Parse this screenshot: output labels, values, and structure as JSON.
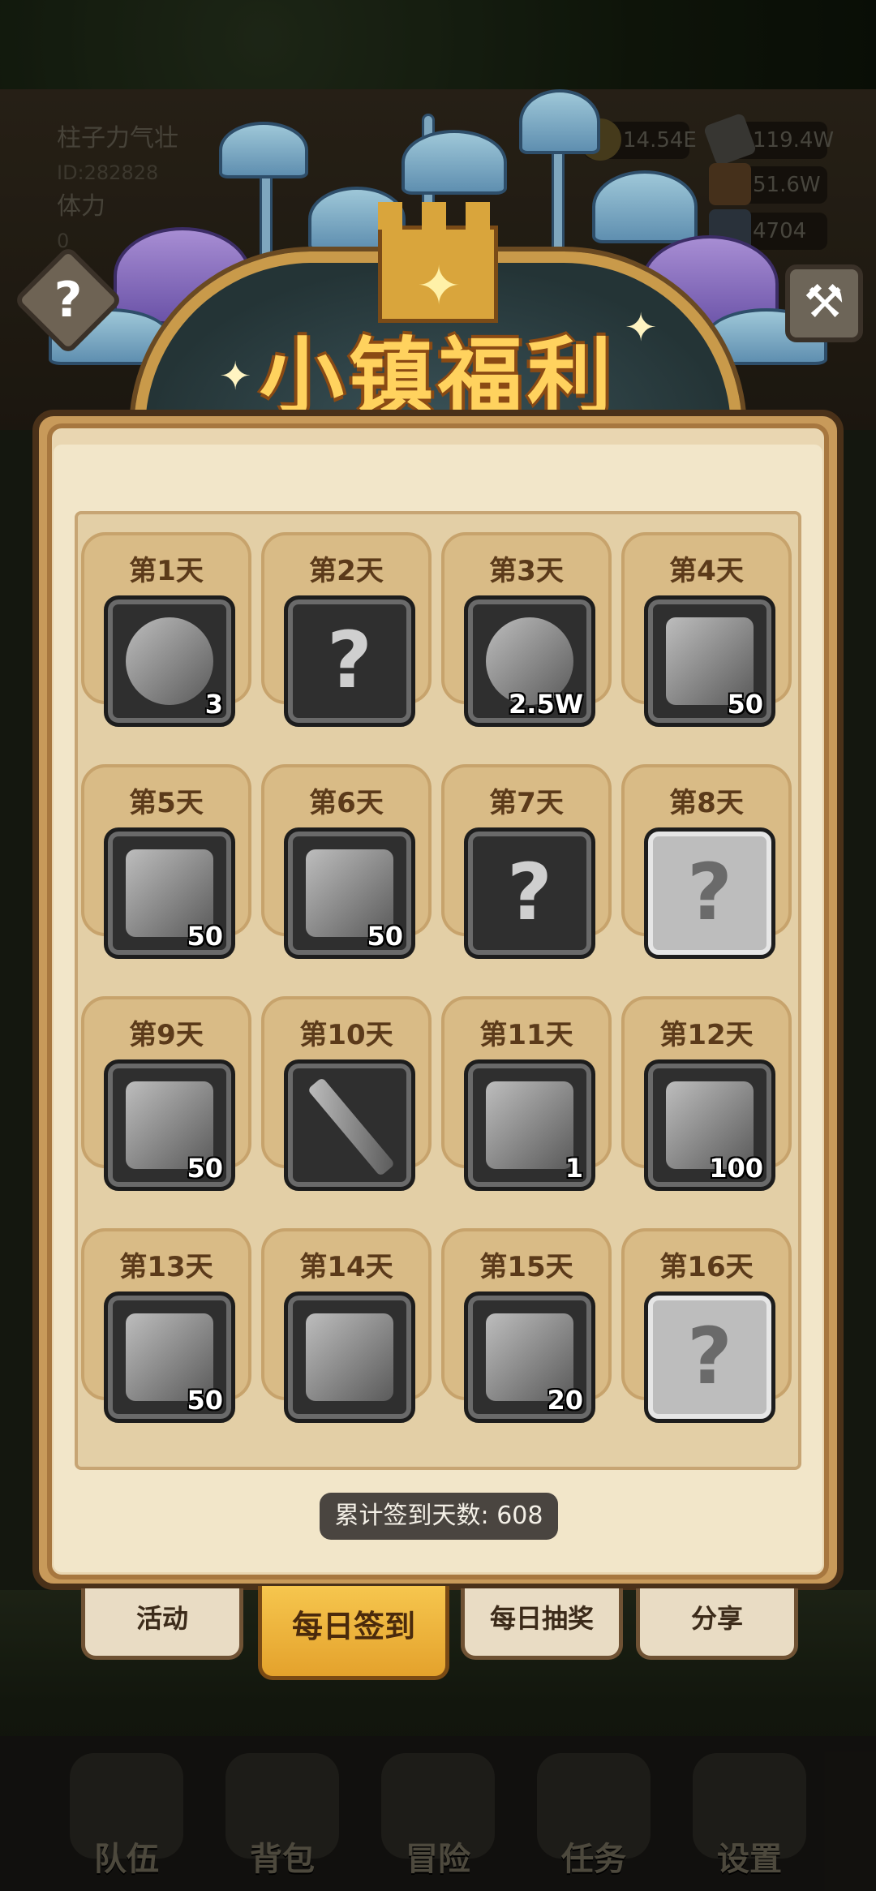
{
  "hud": {
    "player_name": "柱子力气壮",
    "player_id": "ID:282828",
    "stamina_label": "体力",
    "stamina_value": "0",
    "resources": [
      "14.54E",
      "119.4W",
      "51.6W",
      "4704"
    ]
  },
  "dialog": {
    "title": "小镇福利",
    "help_icon": "?",
    "total_checkins": "累计签到天数: 608"
  },
  "days": [
    {
      "label": "第1天",
      "icon": "potion-icon",
      "qty": "3",
      "unknown": false,
      "light": false
    },
    {
      "label": "第2天",
      "icon": "mystery-icon",
      "qty": "",
      "unknown": true,
      "light": false
    },
    {
      "label": "第3天",
      "icon": "money-bag-icon",
      "qty": "2.5W",
      "unknown": false,
      "light": false
    },
    {
      "label": "第4天",
      "icon": "rune-stone-icon",
      "qty": "50",
      "unknown": false,
      "light": false
    },
    {
      "label": "第5天",
      "icon": "ore-icon",
      "qty": "50",
      "unknown": false,
      "light": false
    },
    {
      "label": "第6天",
      "icon": "cloth-icon",
      "qty": "50",
      "unknown": false,
      "light": false
    },
    {
      "label": "第7天",
      "icon": "mystery-icon",
      "qty": "",
      "unknown": true,
      "light": false
    },
    {
      "label": "第8天",
      "icon": "mystery-icon",
      "qty": "",
      "unknown": true,
      "light": true
    },
    {
      "label": "第9天",
      "icon": "ingot-icon",
      "qty": "50",
      "unknown": false,
      "light": false
    },
    {
      "label": "第10天",
      "icon": "sword-icon",
      "qty": "",
      "unknown": false,
      "light": false
    },
    {
      "label": "第11天",
      "icon": "feather-icon",
      "qty": "1",
      "unknown": false,
      "light": false
    },
    {
      "label": "第12天",
      "icon": "rune-stone-icon",
      "qty": "100",
      "unknown": false,
      "light": false
    },
    {
      "label": "第13天",
      "icon": "log-icon",
      "qty": "50",
      "unknown": false,
      "light": false
    },
    {
      "label": "第14天",
      "icon": "backpack-icon",
      "qty": "",
      "unknown": false,
      "light": false
    },
    {
      "label": "第15天",
      "icon": "emblem-stone-icon",
      "qty": "20",
      "unknown": false,
      "light": false
    },
    {
      "label": "第16天",
      "icon": "mystery-icon",
      "qty": "",
      "unknown": true,
      "light": true
    }
  ],
  "tabs": [
    {
      "label": "活动",
      "active": false
    },
    {
      "label": "每日签到",
      "active": true
    },
    {
      "label": "每日抽奖",
      "active": false
    },
    {
      "label": "分享",
      "active": false
    }
  ],
  "nav": [
    {
      "label": "队伍",
      "icon": "helmet-icon"
    },
    {
      "label": "背包",
      "icon": "bag-icon"
    },
    {
      "label": "冒险",
      "icon": "crossed-swords-icon"
    },
    {
      "label": "任务",
      "icon": "quest-icon"
    },
    {
      "label": "设置",
      "icon": "gear-icon"
    }
  ],
  "colors": {
    "title": "#ffd25e",
    "panel": "#f2e6c9",
    "active_tab": "#f6c64e"
  }
}
